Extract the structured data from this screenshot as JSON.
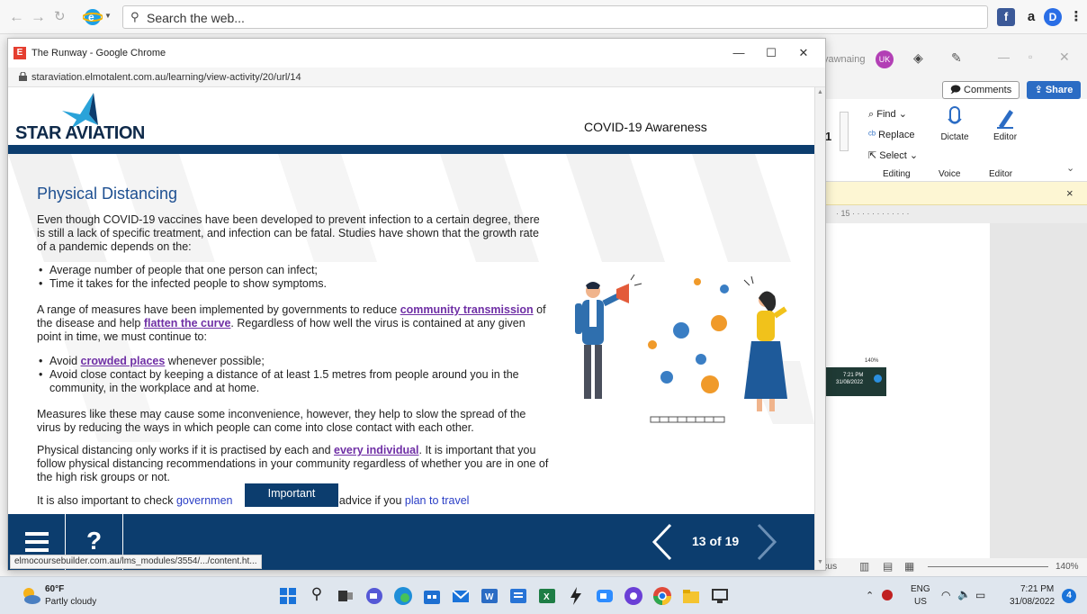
{
  "browser_toolbar": {
    "search_placeholder": "Search the web..."
  },
  "word": {
    "user": "yawnaing",
    "avatar_initials": "UK",
    "comments_label": "Comments",
    "share_label": "Share",
    "find_label": "Find",
    "replace_label": "Replace",
    "select_label": "Select",
    "dictate_label": "Dictate",
    "editor_label": "Editor",
    "group_editing": "Editing",
    "group_voice": "Voice",
    "group_editor": "Editor",
    "font_size_partial": "1",
    "ruler_text": "· 15 · · · · · · · · · · · ·",
    "focus_label": "ocus",
    "zoom_level": "140%",
    "mini_zoom": "140%",
    "mini_time": "7:21 PM",
    "mini_date": "31/08/2022"
  },
  "chrome": {
    "window_title": "The Runway - Google Chrome",
    "favicon_letter": "E",
    "url": "staraviation.elmotalent.com.au/learning/view-activity/20/url/14",
    "status_link": "elmocoursebuilder.com.au/lms_modules/3554/.../content.ht..."
  },
  "course": {
    "logo_text": "STAR AVIATION",
    "course_title": "COVID-19 Awareness",
    "section_title": "Physical Distancing",
    "para1": "Even though COVID-19 vaccines have been developed to prevent infection to a certain degree, there is still a lack of specific treatment, and infection can be fatal. Studies have shown that the growth rate of a pandemic depends on the:",
    "bullets1": [
      "Average number of people that one person can infect;",
      "Time it takes for the infected people to show symptoms."
    ],
    "para2_a": "A range of measures have been implemented by governments to reduce ",
    "link_community": "community transmission",
    "para2_b": " of the disease and help ",
    "link_flatten": "flatten the curve",
    "para2_c": ". Regardless of how well the virus is contained at any given point in time, we must continue to:",
    "bullet2_a": "Avoid ",
    "link_crowded": "crowded places",
    "bullet2_b": " whenever possible;",
    "bullet3": "Avoid close contact by keeping a distance of at least 1.5 metres from people around you in the community, in the workplace and at home.",
    "para3": "Measures like these may cause some inconvenience, however, they help to slow the spread of the virus by reducing the ways in which people can come into close contact with each other.",
    "para4_a": "Physical distancing only works if it is practised by each and ",
    "link_every": "every individual",
    "para4_b": ". It is important that you follow physical distancing recommendations in your community regardless of whether you are in one of the high risk groups or not.",
    "para5_a": "It is also important to check ",
    "link_government": "governmen",
    "para5_b": "d advice if you ",
    "link_travel": "plan to travel",
    "important_label": "Important",
    "page_counter": "13 of 19"
  },
  "taskbar": {
    "temperature": "60°F",
    "condition": "Partly cloudy",
    "lang_top": "ENG",
    "lang_bottom": "US",
    "time": "7:21 PM",
    "date": "31/08/2022",
    "notifications": "4"
  },
  "colors": {
    "brand_navy": "#0c3d6e",
    "link_purple": "#6f2fa5",
    "title_blue": "#1d4f91"
  }
}
